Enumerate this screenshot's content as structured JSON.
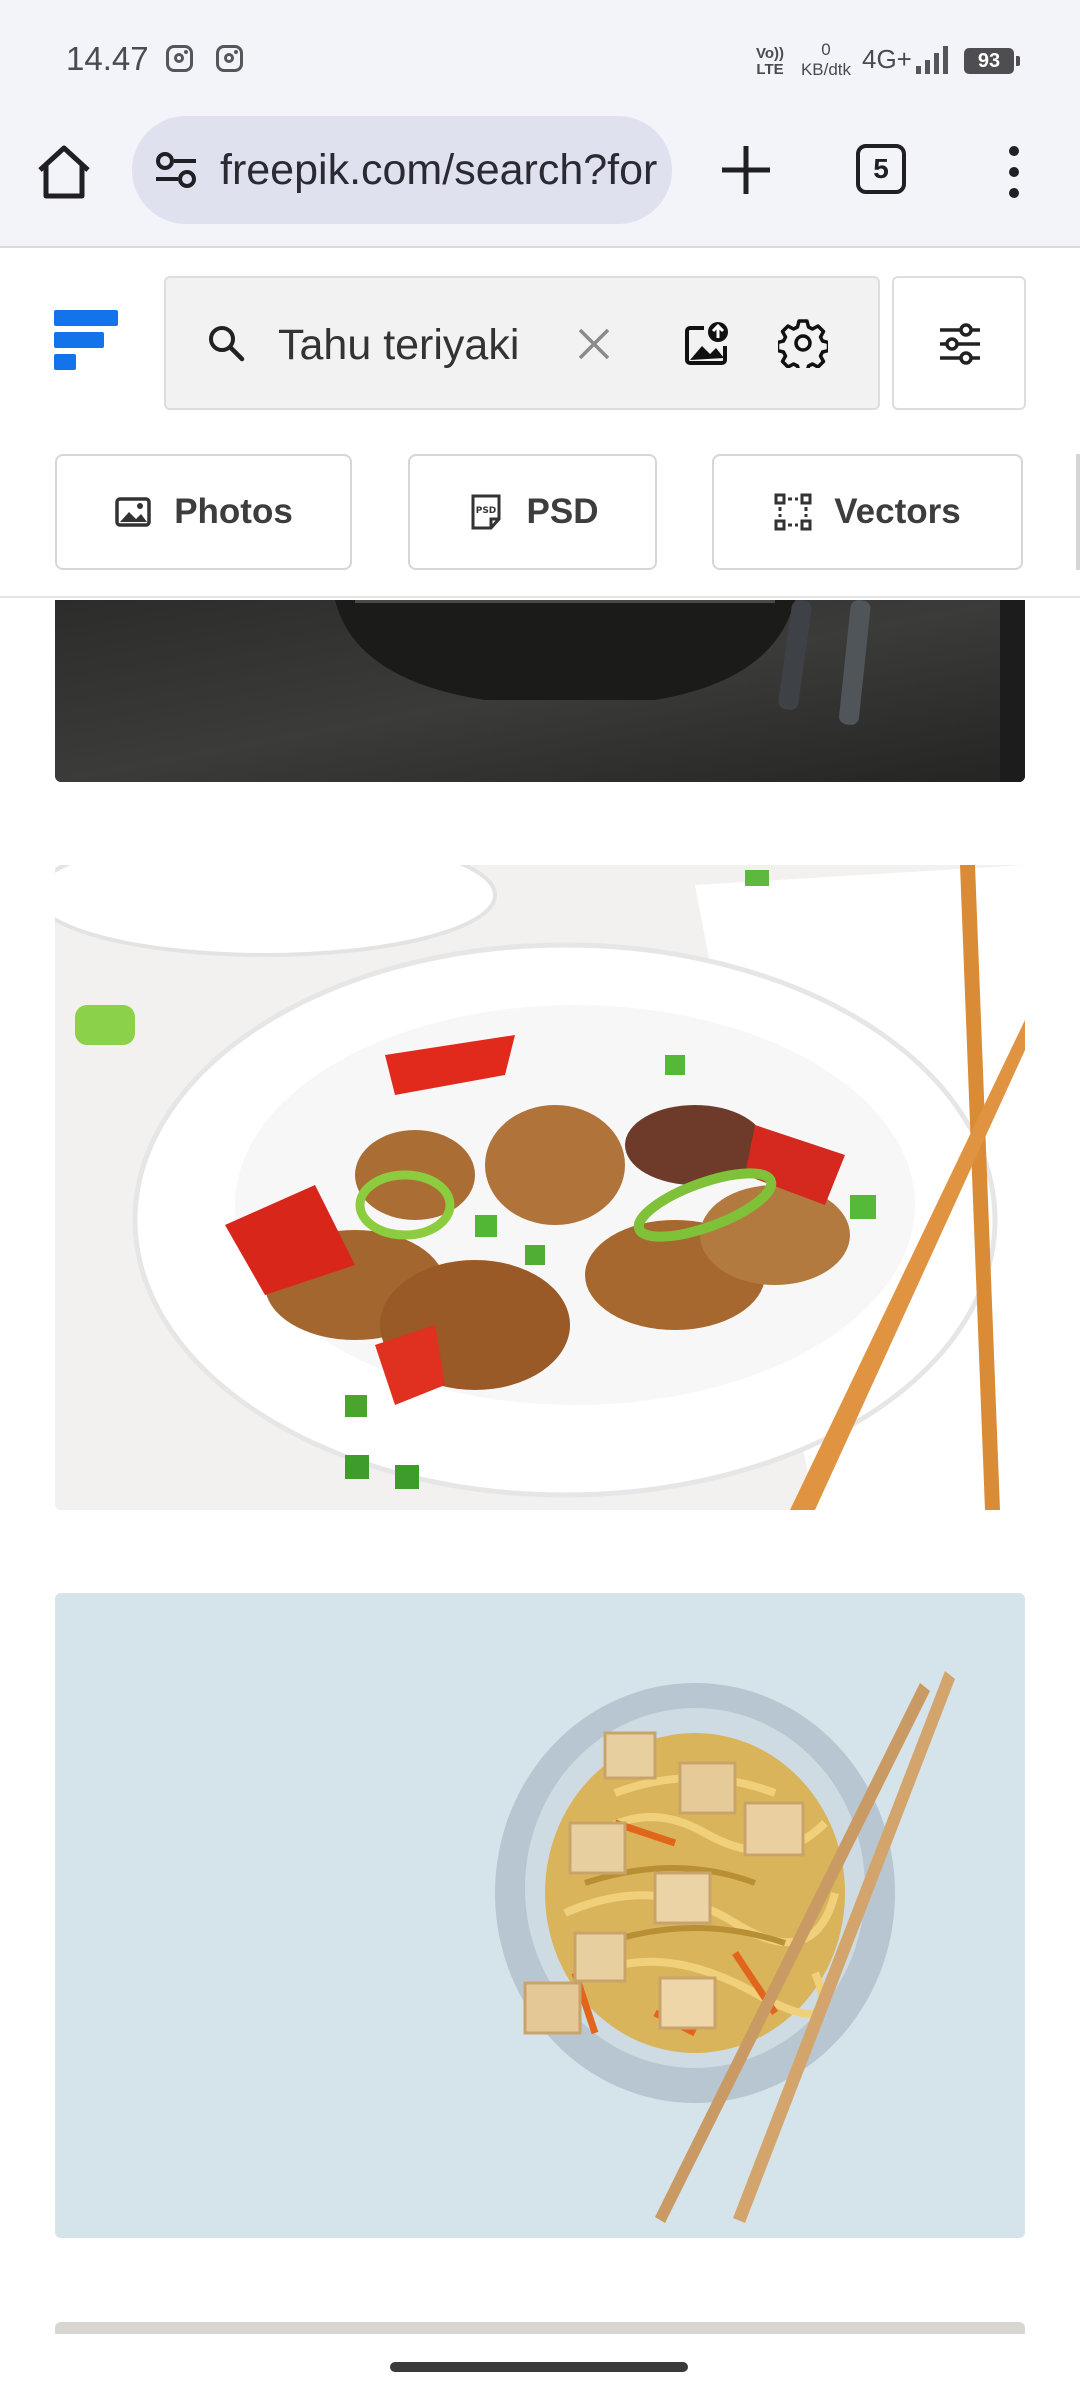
{
  "status_bar": {
    "time": "14.47",
    "notification_icons": [
      "instagram-icon",
      "instagram-icon"
    ],
    "volte": "Vo)) LTE",
    "data_speed_value": "0",
    "data_speed_unit": "KB/dtk",
    "network": "4G+",
    "battery": "93"
  },
  "browser": {
    "url": "freepik.com/search?format=search&query=Tahu teriyaki",
    "tab_count": "5",
    "icons": [
      "home-icon",
      "site-settings-icon",
      "new-tab-icon",
      "tab-switcher-icon",
      "more-menu-icon"
    ]
  },
  "freepik": {
    "search_query": "Tahu teriyaki",
    "search_icons": [
      "search-icon",
      "clear-icon",
      "image-search-icon",
      "settings-icon",
      "filters-icon"
    ],
    "filters": [
      {
        "label": "Photos",
        "icon": "image-icon"
      },
      {
        "label": "PSD",
        "icon": "psd-file-icon"
      },
      {
        "label": "Vectors",
        "icon": "vector-icon"
      }
    ]
  },
  "results": [
    {
      "name": "dark-bowl-with-chopsticks"
    },
    {
      "name": "chicken-stir-fry-with-peppers"
    },
    {
      "name": "noodles-with-tofu-and-chopsticks"
    }
  ],
  "colors": {
    "brand_blue": "#1273eb",
    "toolbar_bg": "#f3f3fa",
    "urlbar_bg": "#dfe1ef"
  }
}
